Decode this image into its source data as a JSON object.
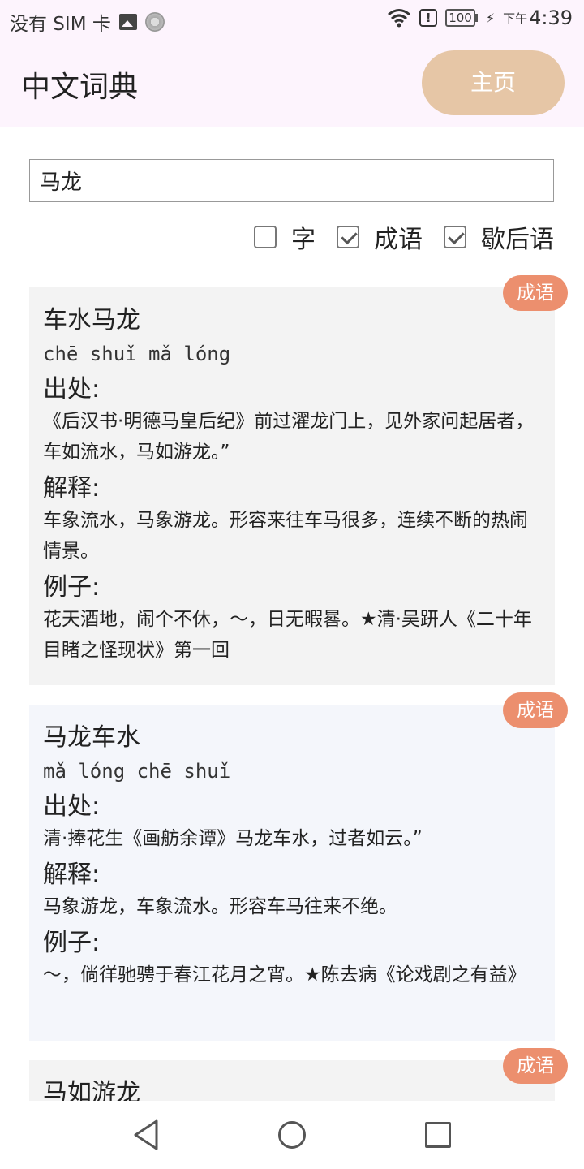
{
  "status_bar": {
    "carrier": "没有 SIM 卡",
    "battery": "100",
    "time_prefix": "下午",
    "time": "4:39"
  },
  "app_bar": {
    "title": "中文词典",
    "home_button": "主页"
  },
  "search": {
    "value": "马龙"
  },
  "filters": [
    {
      "label": "字",
      "checked": false
    },
    {
      "label": "成语",
      "checked": true
    },
    {
      "label": "歇后语",
      "checked": true
    }
  ],
  "results": [
    {
      "badge": "成语",
      "word": "车水马龙",
      "pinyin": "chē shuǐ mǎ lóng",
      "source_label": "出处:",
      "source": "《后汉书·明德马皇后纪》前过濯龙门上，见外家问起居者，车如流水，马如游龙。”",
      "explain_label": "解释:",
      "explain": "车象流水，马象游龙。形容来往车马很多，连续不断的热闹情景。",
      "example_label": "例子:",
      "example": "花天酒地，闹个不休，～，日无暇晷。★清·吴趼人《二十年目睹之怪现状》第一回"
    },
    {
      "badge": "成语",
      "word": "马龙车水",
      "pinyin": "mǎ lóng chē shuǐ",
      "source_label": "出处:",
      "source": "清·捧花生《画舫余谭》马龙车水，过者如云。”",
      "explain_label": "解释:",
      "explain": "马象游龙，车象流水。形容车马往来不绝。",
      "example_label": "例子:",
      "example": "～，倘徉驰骋于春江花月之宵。★陈去病《论戏剧之有益》"
    },
    {
      "badge": "成语",
      "word": "马如游龙"
    }
  ],
  "icons": {
    "back": "back-triangle-icon",
    "home": "home-circle-icon",
    "recent": "recent-square-icon"
  }
}
